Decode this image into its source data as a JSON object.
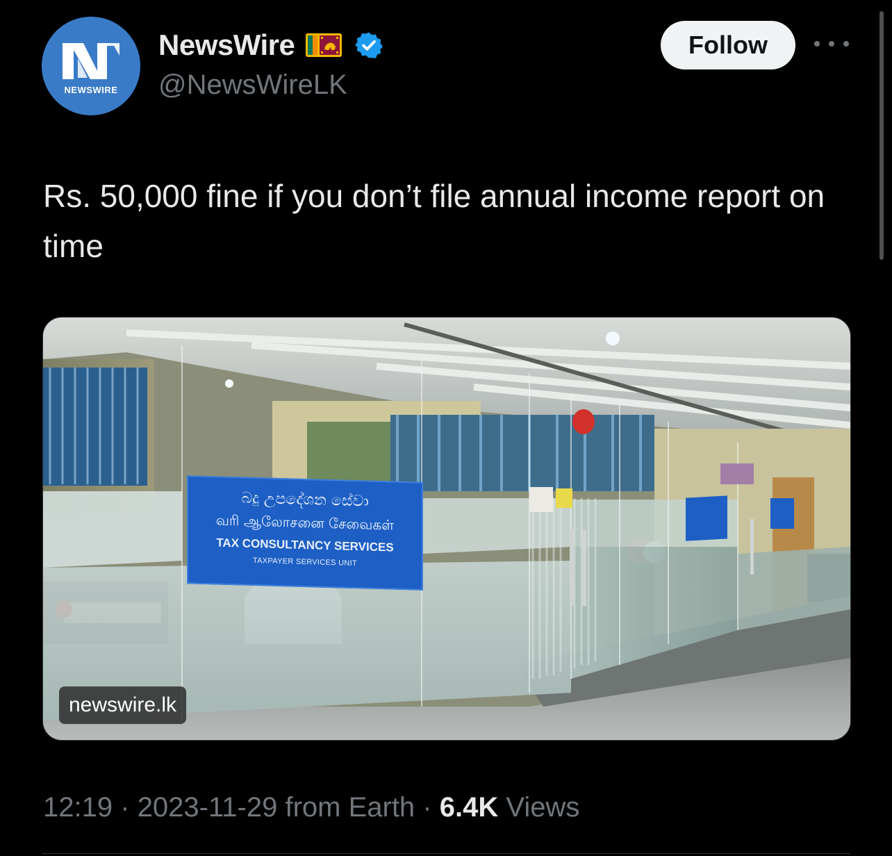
{
  "author": {
    "display_name": "NewsWire",
    "handle": "@NewsWireLK",
    "avatar_label": "NEWSWIRE",
    "flag": "sri-lanka-flag-emoji",
    "verified": true
  },
  "actions": {
    "follow_label": "Follow",
    "more_icon": "more-horizontal-icon"
  },
  "tweet": {
    "text": "Rs. 50,000 fine if you don’t file annual income report on time"
  },
  "media": {
    "sign_line1": "බදු උපදේශන සේවා",
    "sign_line2": "வரி ஆலோசனை சேவைகள்",
    "sign_line3": "TAX CONSULTANCY SERVICES",
    "sign_line4": "TAXPAYER SERVICES UNIT",
    "source": "newswire.lk"
  },
  "meta": {
    "time": "12:19",
    "date": "2023-11-29",
    "client": "from Earth",
    "separator": "·",
    "views_count": "6.4K",
    "views_label": "Views"
  },
  "colors": {
    "background": "#000000",
    "text_primary": "#e7e9ea",
    "text_secondary": "#71767b",
    "verified_blue": "#1d9bf0",
    "avatar_blue": "#3a7bc8"
  }
}
